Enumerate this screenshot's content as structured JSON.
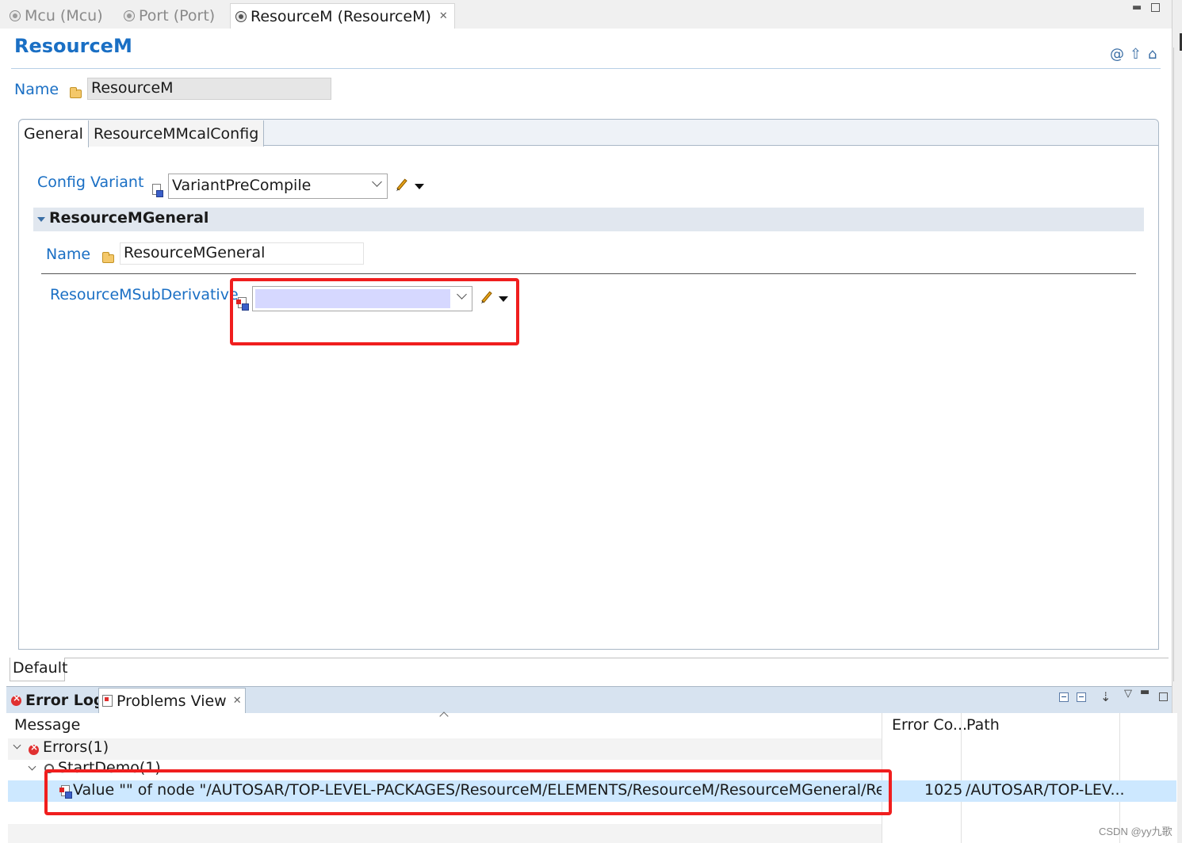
{
  "editor_tabs": [
    {
      "label": "Mcu (Mcu)",
      "active": false
    },
    {
      "label": "Port (Port)",
      "active": false
    },
    {
      "label": "ResourceM (ResourceM)",
      "active": true
    }
  ],
  "tab_close_glyph": "✕",
  "form": {
    "title": "ResourceM",
    "name_label": "Name",
    "name_value": "ResourceM"
  },
  "inner_tabs": [
    "General",
    "ResourceMMcalConfig"
  ],
  "general": {
    "config_variant_label": "Config Variant",
    "config_variant_value": "VariantPreCompile",
    "section_title": "ResourceMGeneral",
    "section_name_label": "Name",
    "section_name_value": "ResourceMGeneral",
    "subderivative_label": "ResourceMSubDerivative",
    "subderivative_value": ""
  },
  "bottom_tab": "Default",
  "problems_view": {
    "tabs": [
      "Error Log",
      "Problems View"
    ],
    "columns": [
      "Message",
      "Error Co...",
      "Path"
    ],
    "errors_group": "Errors(1)",
    "project": "StartDemo(1)",
    "error_message": "Value \"\" of node \"/AUTOSAR/TOP-LEVEL-PACKAGES/ResourceM/ELEMENTS/ResourceM/ResourceMGeneral/ResourceM",
    "error_code": "1025",
    "error_path": "/AUTOSAR/TOP-LEV..."
  },
  "colors": {
    "accent": "#1a6fc4",
    "highlight_box": "#f01e1e",
    "empty_field_fill": "#d6d8ff",
    "selection": "#cde8ff"
  },
  "watermark": "CSDN @yy九歌"
}
